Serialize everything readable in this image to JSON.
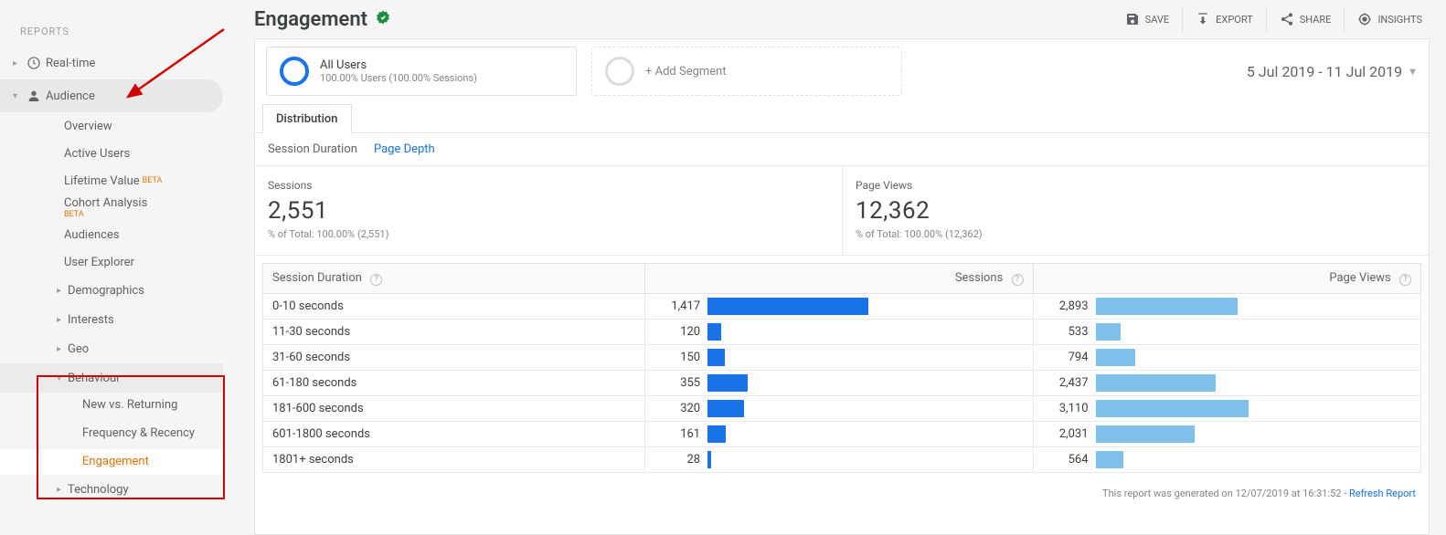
{
  "sidebar": {
    "section": "REPORTS",
    "realtime": "Real-time",
    "audience": "Audience",
    "audience_sub": {
      "overview": "Overview",
      "active": "Active Users",
      "lifetime": "Lifetime Value",
      "cohort": "Cohort Analysis",
      "audiences": "Audiences",
      "explorer": "User Explorer",
      "demo": "Demographics",
      "interests": "Interests",
      "geo": "Geo",
      "behaviour": "Behaviour",
      "beh_new": "New vs. Returning",
      "beh_freq": "Frequency & Recency",
      "beh_eng": "Engagement",
      "tech": "Technology"
    },
    "beta": "BETA"
  },
  "header": {
    "title": "Engagement",
    "actions": {
      "save": "SAVE",
      "export": "EXPORT",
      "share": "SHARE",
      "insights": "INSIGHTS"
    }
  },
  "segments": {
    "all_users": "All Users",
    "all_users_sub": "100.00% Users (100.00% Sessions)",
    "add": "+ Add Segment",
    "date_range": "5 Jul 2019 - 11 Jul 2019"
  },
  "tabs": {
    "distribution": "Distribution"
  },
  "subtabs": {
    "duration": "Session Duration",
    "depth": "Page Depth"
  },
  "metrics": {
    "sessions": {
      "label": "Sessions",
      "value": "2,551",
      "sub": "% of Total: 100.00% (2,551)"
    },
    "pageviews": {
      "label": "Page Views",
      "value": "12,362",
      "sub": "% of Total: 100.00% (12,362)"
    }
  },
  "table": {
    "col_duration": "Session Duration",
    "col_sessions": "Sessions",
    "col_pageviews": "Page Views",
    "rows": [
      {
        "bucket": "0-10 seconds",
        "sessions": "1,417",
        "s_pct": 100.0,
        "pageviews": "2,893",
        "p_pct": 61.3
      },
      {
        "bucket": "11-30 seconds",
        "sessions": "120",
        "s_pct": 8.5,
        "pageviews": "533",
        "p_pct": 11.0
      },
      {
        "bucket": "31-60 seconds",
        "sessions": "150",
        "s_pct": 10.6,
        "pageviews": "794",
        "p_pct": 17.0
      },
      {
        "bucket": "61-180 seconds",
        "sessions": "355",
        "s_pct": 25.1,
        "pageviews": "2,437",
        "p_pct": 52.0
      },
      {
        "bucket": "181-600 seconds",
        "sessions": "320",
        "s_pct": 22.6,
        "pageviews": "3,110",
        "p_pct": 66.0
      },
      {
        "bucket": "601-1800 seconds",
        "sessions": "161",
        "s_pct": 11.4,
        "pageviews": "2,031",
        "p_pct": 43.0
      },
      {
        "bucket": "1801+ seconds",
        "sessions": "28",
        "s_pct": 2.0,
        "pageviews": "564",
        "p_pct": 12.0
      }
    ]
  },
  "footer": {
    "generated": "This report was generated on 12/07/2019 at 16:31:52 - ",
    "refresh": "Refresh Report"
  },
  "chart_data": {
    "type": "bar",
    "title": "Engagement — Session Duration distribution",
    "categories": [
      "0-10",
      "11-30",
      "31-60",
      "61-180",
      "181-600",
      "601-1800",
      "1801+"
    ],
    "series": [
      {
        "name": "Sessions",
        "values": [
          1417,
          120,
          150,
          355,
          320,
          161,
          28
        ]
      },
      {
        "name": "Page Views",
        "values": [
          2893,
          533,
          794,
          2437,
          3110,
          2031,
          564
        ]
      }
    ],
    "xlabel": "Session Duration (seconds)",
    "ylabel": "",
    "ylim": [
      0,
      3200
    ]
  }
}
